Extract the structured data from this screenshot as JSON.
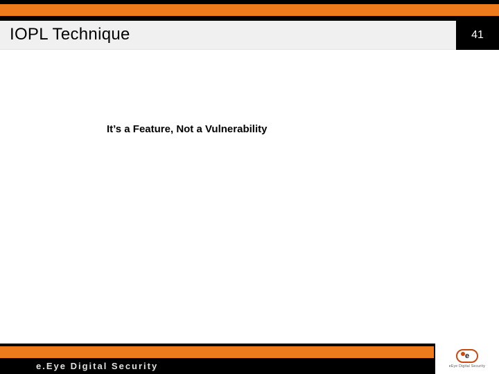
{
  "header": {
    "title": "IOPL Technique",
    "page_number": "41"
  },
  "body": {
    "headline": "It’s a Feature, Not a Vulnerability"
  },
  "footer": {
    "brand_text": "e.Eye Digital Security",
    "logo_letter": "e",
    "logo_subtext": "eEye Digital Security"
  },
  "colors": {
    "accent_orange": "#ed7b1c",
    "black": "#000000",
    "title_band": "#f0f0f0"
  }
}
